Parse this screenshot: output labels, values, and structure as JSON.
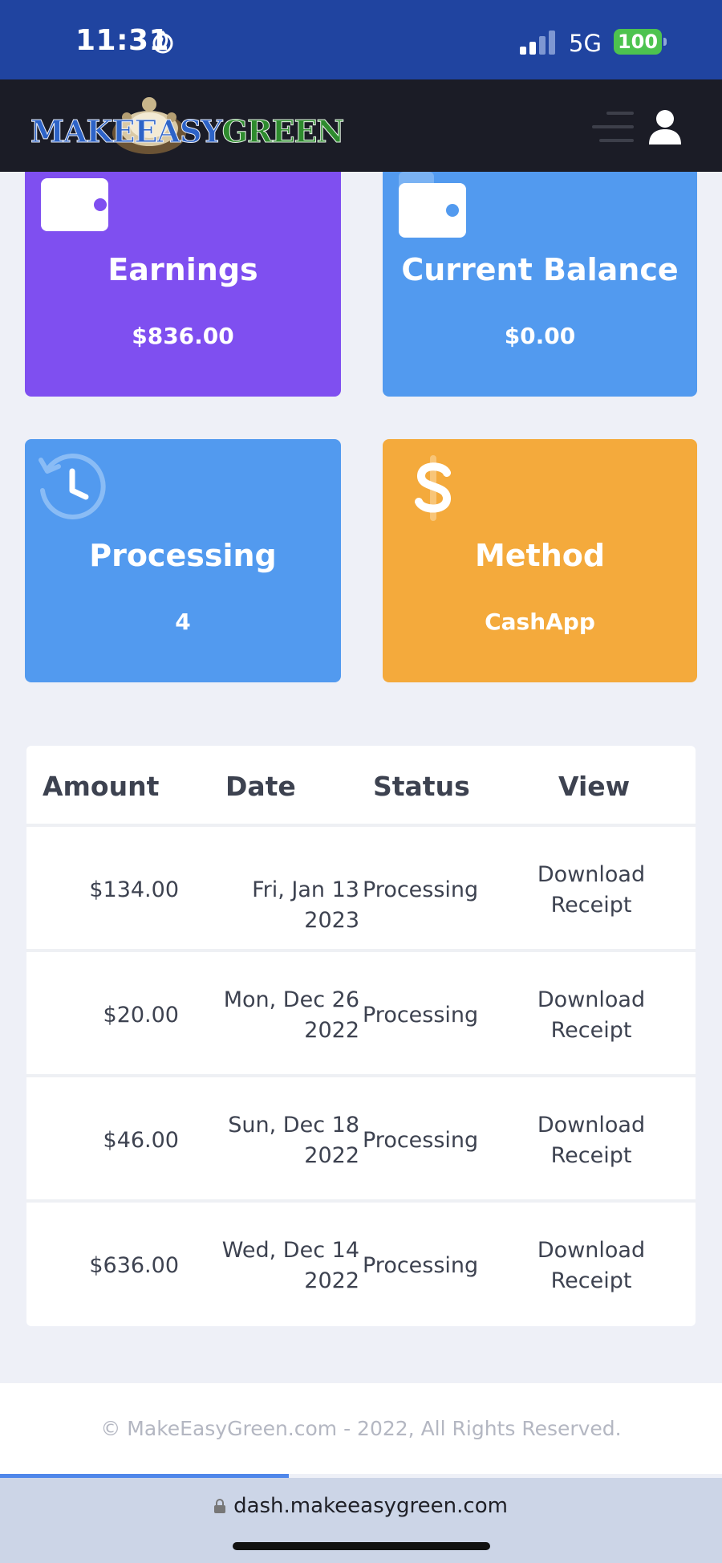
{
  "status_bar": {
    "time": "11:31",
    "network": "5G",
    "battery": "100"
  },
  "header": {
    "logo_text_blue": "MAKEEASY",
    "logo_text_green": "GREEN"
  },
  "cards": {
    "earnings": {
      "title": "Earnings",
      "value": "$836.00"
    },
    "balance": {
      "title": "Current Balance",
      "value": "$0.00"
    },
    "processing": {
      "title": "Processing",
      "value": "4"
    },
    "method": {
      "title": "Method",
      "value": "CashApp"
    }
  },
  "table": {
    "headers": [
      "Amount",
      "Date",
      "Status",
      "View"
    ],
    "rows": [
      {
        "amount": "$134.00",
        "date": "Fri, Jan 13 2023",
        "status": "Processing",
        "view": "Download Receipt"
      },
      {
        "amount": "$20.00",
        "date": "Mon, Dec 26 2022",
        "status": "Processing",
        "view": "Download Receipt"
      },
      {
        "amount": "$46.00",
        "date": "Sun, Dec 18 2022",
        "status": "Processing",
        "view": "Download Receipt"
      },
      {
        "amount": "$636.00",
        "date": "Wed, Dec 14 2022",
        "status": "Processing",
        "view": "Download Receipt"
      }
    ]
  },
  "footer": {
    "copyright": "© MakeEasyGreen.com - 2022, All Rights Reserved."
  },
  "browser": {
    "url": "dash.makeeasygreen.com",
    "load_progress": 0.4
  },
  "colors": {
    "earnings": "#7f4ff0",
    "balance": "#529aef",
    "processing": "#529aef",
    "method": "#f4aa3c",
    "header": "#1b1c26",
    "status_bar": "#2044a0"
  }
}
